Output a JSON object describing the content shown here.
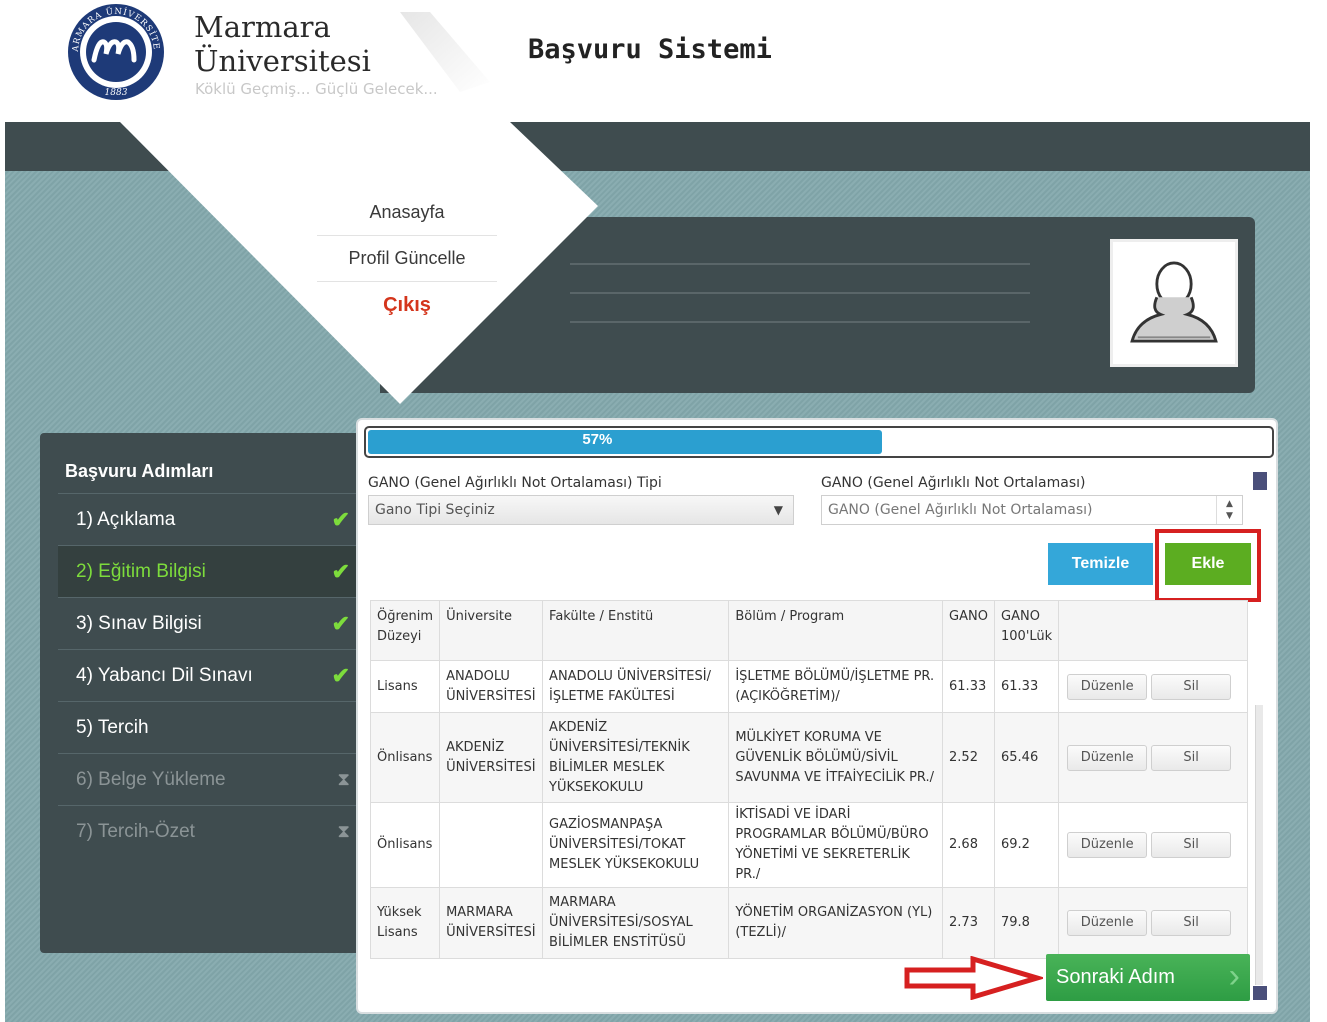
{
  "header": {
    "brand_name": "Marmara\nÜniversitesi",
    "slogan": "Köklü Geçmiş... Güçlü Gelecek...",
    "system_title": "Başvuru Sistemi",
    "seal_text_top": "MARMARA ÜNİVERSİTESİ",
    "seal_year": "1883"
  },
  "menu": {
    "items": [
      "Anasayfa",
      "Profil Güncelle",
      "Çıkış"
    ]
  },
  "steps": {
    "title": "Başvuru Adımları",
    "items": [
      {
        "label": "1) Açıklama",
        "status": "done"
      },
      {
        "label": "2) Eğitim Bilgisi",
        "status": "active"
      },
      {
        "label": "3) Sınav Bilgisi",
        "status": "done"
      },
      {
        "label": "4) Yabancı Dil Sınavı",
        "status": "done"
      },
      {
        "label": "5) Tercih",
        "status": "open"
      },
      {
        "label": "6) Belge Yükleme",
        "status": "locked"
      },
      {
        "label": "7) Tercih-Özet",
        "status": "locked"
      }
    ]
  },
  "progress": {
    "value": 0.57,
    "label": "57%"
  },
  "form": {
    "gano_type_label": "GANO (Genel Ağırlıklı Not Ortalaması) Tipi",
    "gano_type_selected": "Gano Tipi Seçiniz",
    "gano_label": "GANO (Genel Ağırlıklı Not Ortalaması)",
    "gano_placeholder": "GANO (Genel Ağırlıklı Not Ortalaması)",
    "clear_label": "Temizle",
    "add_label": "Ekle"
  },
  "table": {
    "headers": [
      "Öğrenim Düzeyi",
      "Üniversite",
      "Fakülte / Enstitü",
      "Bölüm / Program",
      "GANO",
      "GANO 100'Lük",
      ""
    ],
    "rows": [
      [
        "Lisans",
        "ANADOLU ÜNİVERSİTESİ",
        "ANADOLU ÜNİVERSİTESİ/ İŞLETME FAKÜLTESİ",
        "İŞLETME BÖLÜMÜ/İŞLETME PR. (AÇIKÖĞRETİM)/",
        "61.33",
        "61.33"
      ],
      [
        "Önlisans",
        "AKDENİZ ÜNİVERSİTESİ",
        "AKDENİZ ÜNİVERSİTESİ/TEKNİK BİLİMLER MESLEK YÜKSEKOKULU",
        "MÜLKİYET KORUMA VE GÜVENLİK BÖLÜMÜ/SİVİL SAVUNMA VE İTFAİYECİLİK PR./",
        "2.52",
        "65.46"
      ],
      [
        "Önlisans",
        "",
        "GAZİOSMANPAŞA ÜNİVERSİTESİ/TOKAT MESLEK YÜKSEKOKULU",
        "İKTİSADİ VE İDARİ PROGRAMLAR BÖLÜMÜ/BÜRO YÖNETİMİ VE SEKRETERLİK PR./",
        "2.68",
        "69.2"
      ],
      [
        "Yüksek Lisans",
        "MARMARA ÜNİVERSİTESİ",
        "MARMARA ÜNİVERSİTESİ/SOSYAL BİLİMLER ENSTİTÜSÜ",
        "YÖNETİM ORGANİZASYON (YL) (TEZLİ)/",
        "2.73",
        "79.8"
      ]
    ],
    "edit_label": "Düzenle",
    "delete_label": "Sil"
  },
  "next_label": "Sonraki Adım",
  "colors": {
    "accent_green": "#5cad21",
    "accent_blue": "#34a7d9",
    "highlight_red": "#d62020",
    "step_done": "#7ddc3c",
    "exit_red": "#d4351c"
  }
}
